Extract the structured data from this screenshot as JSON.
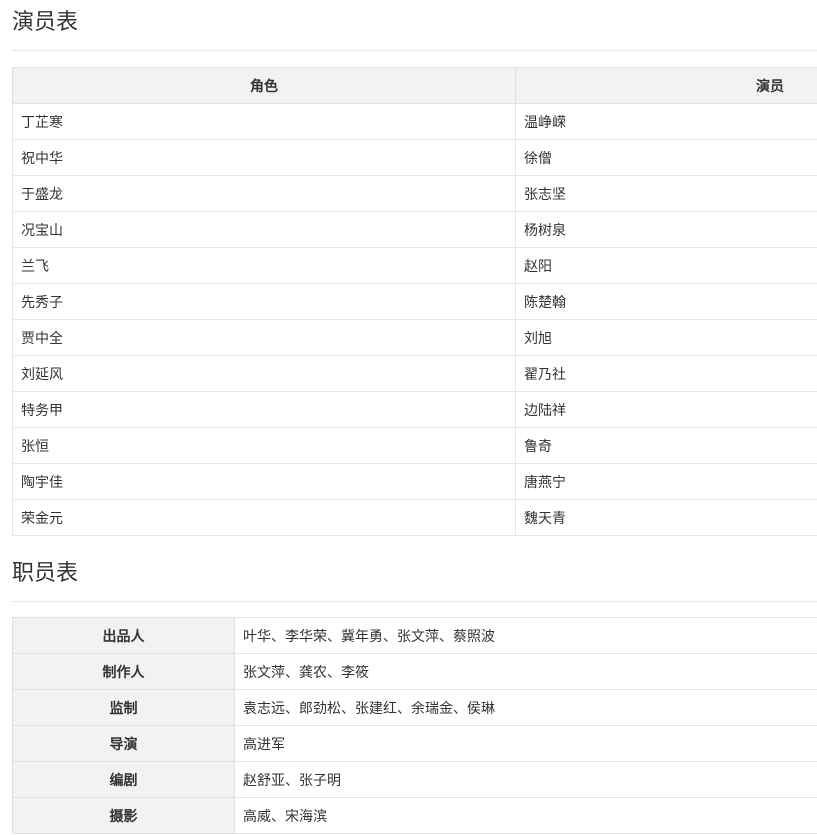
{
  "cast": {
    "title": "演员表",
    "headers": {
      "role": "角色",
      "actor": "演员"
    },
    "rows": [
      {
        "role": "丁芷寒",
        "actor": "温峥嵘"
      },
      {
        "role": "祝中华",
        "actor": "徐僧"
      },
      {
        "role": "于盛龙",
        "actor": "张志坚"
      },
      {
        "role": "况宝山",
        "actor": "杨树泉"
      },
      {
        "role": "兰飞",
        "actor": "赵阳"
      },
      {
        "role": "先秀子",
        "actor": "陈楚翰"
      },
      {
        "role": "贾中全",
        "actor": "刘旭"
      },
      {
        "role": "刘延风",
        "actor": "翟乃社"
      },
      {
        "role": "特务甲",
        "actor": "边陆祥"
      },
      {
        "role": "张恒",
        "actor": "鲁奇"
      },
      {
        "role": "陶宇佳",
        "actor": "唐燕宁"
      },
      {
        "role": "荣金元",
        "actor": "魏天青"
      }
    ]
  },
  "crew": {
    "title": "职员表",
    "rows": [
      {
        "position": "出品人",
        "names": "叶华、李华荣、冀年勇、张文萍、蔡照波"
      },
      {
        "position": "制作人",
        "names": "张文萍、龚农、李筱"
      },
      {
        "position": "监制",
        "names": "袁志远、郎劲松、张建红、余瑞金、侯琳"
      },
      {
        "position": "导演",
        "names": "高进军"
      },
      {
        "position": "编剧",
        "names": "赵舒亚、张子明"
      },
      {
        "position": "摄影",
        "names": "高威、宋海滨"
      }
    ]
  }
}
